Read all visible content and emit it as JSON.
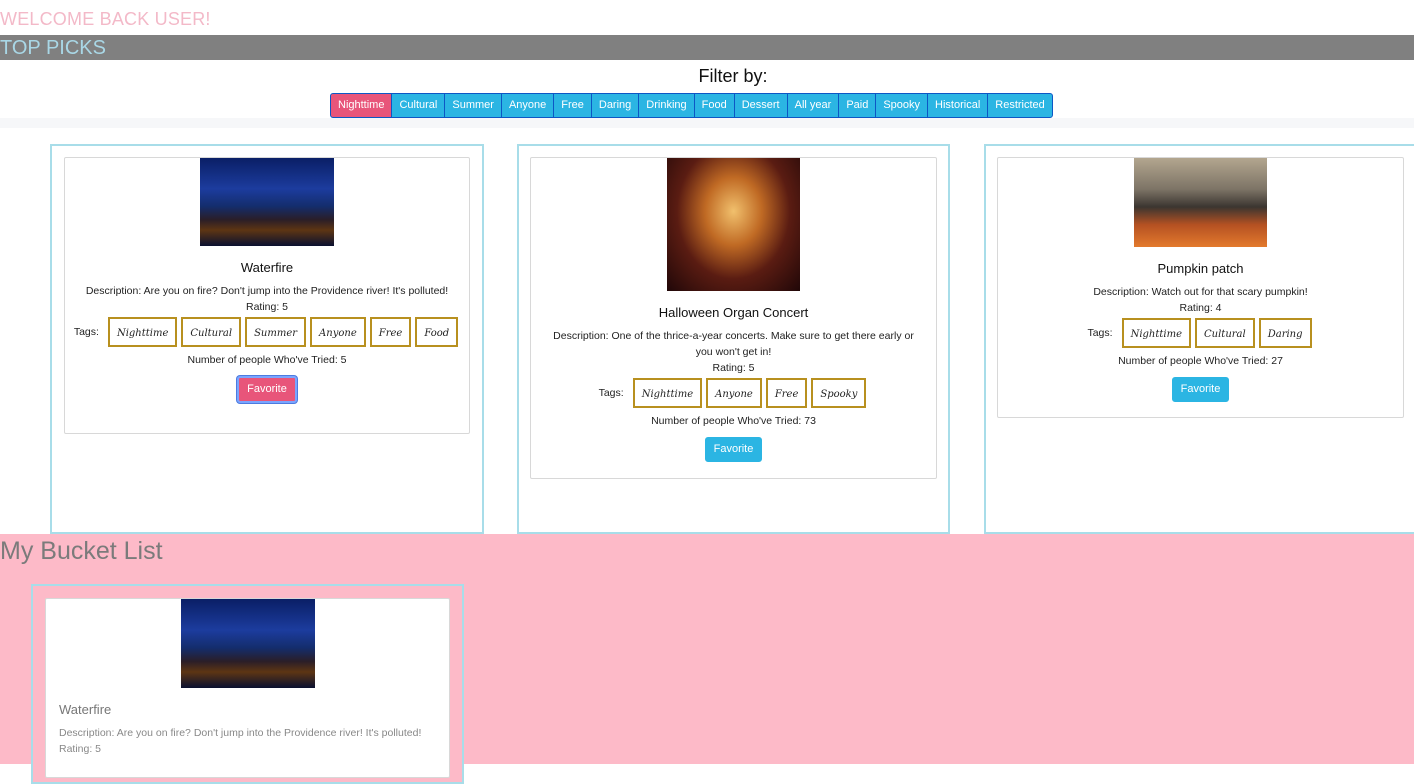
{
  "header": {
    "welcome": "WELCOME BACK USER!",
    "section_title": "TOP PICKS"
  },
  "filter": {
    "title": "Filter by:",
    "options": [
      "Nighttime",
      "Cultural",
      "Summer",
      "Anyone",
      "Free",
      "Daring",
      "Drinking",
      "Food",
      "Dessert",
      "All year",
      "Paid",
      "Spooky",
      "Historical",
      "Restricted"
    ],
    "active": "Nighttime"
  },
  "picks": [
    {
      "title": "Waterfire",
      "description": "Description: Are you on fire? Don't jump into the Providence river! It's polluted!",
      "rating": "Rating: 5",
      "tags_label": "Tags:",
      "tags": [
        "Nighttime",
        "Cultural",
        "Summer",
        "Anyone",
        "Free",
        "Food"
      ],
      "tried": "Number of people Who've Tried: 5",
      "favorite_label": "Favorite",
      "favorited": true
    },
    {
      "title": "Halloween Organ Concert",
      "description": "Description: One of the thrice-a-year concerts. Make sure to get there early or you won't get in!",
      "rating": "Rating: 5",
      "tags_label": "Tags:",
      "tags": [
        "Nighttime",
        "Anyone",
        "Free",
        "Spooky"
      ],
      "tried": "Number of people Who've Tried: 73",
      "favorite_label": "Favorite",
      "favorited": false
    },
    {
      "title": "Pumpkin patch",
      "description": "Description: Watch out for that scary pumpkin!",
      "rating": "Rating: 4",
      "tags_label": "Tags:",
      "tags": [
        "Nighttime",
        "Cultural",
        "Daring"
      ],
      "tried": "Number of people Who've Tried: 27",
      "favorite_label": "Favorite",
      "favorited": false
    }
  ],
  "bucket_list": {
    "title": "My Bucket List",
    "items": [
      {
        "title": "Waterfire",
        "description": "Description: Are you on fire? Don't jump into the Providence river! It's polluted!",
        "rating": "Rating: 5"
      }
    ]
  },
  "colors": {
    "accent": "#2bb5e3",
    "active": "#e8557a",
    "tag_border": "#b8901f",
    "bucket_bg": "#fdbac8"
  }
}
